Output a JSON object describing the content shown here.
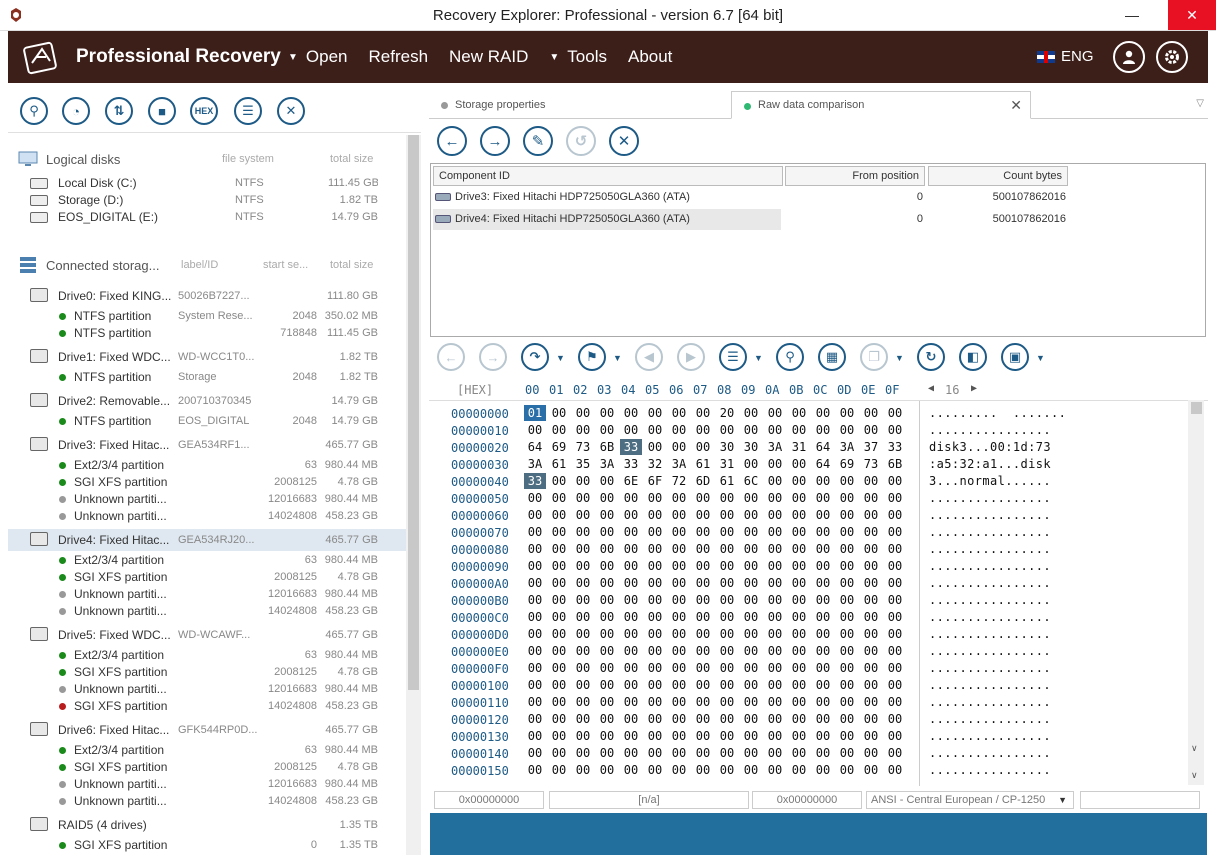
{
  "window": {
    "title": "Recovery Explorer: Professional - version 6.7 [64 bit]"
  },
  "header": {
    "brand": "Professional Recovery",
    "menu": [
      {
        "label": "Open",
        "dropdown": true
      },
      {
        "label": "Refresh",
        "dropdown": false
      },
      {
        "label": "New RAID",
        "dropdown": false
      },
      {
        "label": "Tools",
        "dropdown": true
      },
      {
        "label": "About",
        "dropdown": false
      }
    ],
    "language": "ENG"
  },
  "left_toolbar": {
    "hex_label": "HEX"
  },
  "logical_disks": {
    "title": "Logical disks",
    "col_fs": "file system",
    "col_size": "total size",
    "items": [
      {
        "name": "Local Disk (C:)",
        "fs": "NTFS",
        "size": "111.45 GB"
      },
      {
        "name": "Storage (D:)",
        "fs": "NTFS",
        "size": "1.82 TB"
      },
      {
        "name": "EOS_DIGITAL (E:)",
        "fs": "NTFS",
        "size": "14.79 GB"
      }
    ]
  },
  "connected_storage": {
    "title": "Connected storag...",
    "col_label": "label/ID",
    "col_start": "start se...",
    "col_size": "total size",
    "rows": [
      {
        "kind": "drive",
        "name": "Drive0: Fixed KING...",
        "label": "50026B7227...",
        "start": "",
        "size": "111.80 GB"
      },
      {
        "kind": "part",
        "status": "green",
        "name": "NTFS partition",
        "label": "System Rese...",
        "start": "2048",
        "size": "350.02 MB"
      },
      {
        "kind": "part",
        "status": "green",
        "name": "NTFS partition",
        "label": "",
        "start": "718848",
        "size": "111.45 GB"
      },
      {
        "kind": "drive",
        "name": "Drive1: Fixed WDC...",
        "label": "WD-WCC1T0...",
        "start": "",
        "size": "1.82 TB"
      },
      {
        "kind": "part",
        "status": "green",
        "name": "NTFS partition",
        "label": "Storage",
        "start": "2048",
        "size": "1.82 TB"
      },
      {
        "kind": "drive",
        "name": "Drive2: Removable...",
        "label": "200710370345",
        "start": "",
        "size": "14.79 GB"
      },
      {
        "kind": "part",
        "status": "green",
        "name": "NTFS partition",
        "label": "EOS_DIGITAL",
        "start": "2048",
        "size": "14.79 GB"
      },
      {
        "kind": "drive",
        "name": "Drive3: Fixed Hitac...",
        "label": "GEA534RF1...",
        "start": "",
        "size": "465.77 GB"
      },
      {
        "kind": "part",
        "status": "green",
        "name": "Ext2/3/4 partition",
        "label": "",
        "start": "63",
        "size": "980.44 MB"
      },
      {
        "kind": "part",
        "status": "green",
        "name": "SGI XFS partition",
        "label": "",
        "start": "2008125",
        "size": "4.78 GB"
      },
      {
        "kind": "part",
        "status": "gray",
        "name": "Unknown partiti...",
        "label": "",
        "start": "12016683",
        "size": "980.44 MB"
      },
      {
        "kind": "part",
        "status": "gray",
        "name": "Unknown partiti...",
        "label": "",
        "start": "14024808",
        "size": "458.23 GB"
      },
      {
        "kind": "drive",
        "selected": true,
        "name": "Drive4: Fixed Hitac...",
        "label": "GEA534RJ20...",
        "start": "",
        "size": "465.77 GB"
      },
      {
        "kind": "part",
        "status": "green",
        "name": "Ext2/3/4 partition",
        "label": "",
        "start": "63",
        "size": "980.44 MB"
      },
      {
        "kind": "part",
        "status": "green",
        "name": "SGI XFS partition",
        "label": "",
        "start": "2008125",
        "size": "4.78 GB"
      },
      {
        "kind": "part",
        "status": "gray",
        "name": "Unknown partiti...",
        "label": "",
        "start": "12016683",
        "size": "980.44 MB"
      },
      {
        "kind": "part",
        "status": "gray",
        "name": "Unknown partiti...",
        "label": "",
        "start": "14024808",
        "size": "458.23 GB"
      },
      {
        "kind": "drive",
        "name": "Drive5: Fixed WDC...",
        "label": "WD-WCAWF...",
        "start": "",
        "size": "465.77 GB"
      },
      {
        "kind": "part",
        "status": "green",
        "name": "Ext2/3/4 partition",
        "label": "",
        "start": "63",
        "size": "980.44 MB"
      },
      {
        "kind": "part",
        "status": "green",
        "name": "SGI XFS partition",
        "label": "",
        "start": "2008125",
        "size": "4.78 GB"
      },
      {
        "kind": "part",
        "status": "gray",
        "name": "Unknown partiti...",
        "label": "",
        "start": "12016683",
        "size": "980.44 MB"
      },
      {
        "kind": "part",
        "status": "red",
        "name": "SGI XFS partition",
        "label": "",
        "start": "14024808",
        "size": "458.23 GB"
      },
      {
        "kind": "drive",
        "name": "Drive6: Fixed Hitac...",
        "label": "GFK544RP0D...",
        "start": "",
        "size": "465.77 GB"
      },
      {
        "kind": "part",
        "status": "green",
        "name": "Ext2/3/4 partition",
        "label": "",
        "start": "63",
        "size": "980.44 MB"
      },
      {
        "kind": "part",
        "status": "green",
        "name": "SGI XFS partition",
        "label": "",
        "start": "2008125",
        "size": "4.78 GB"
      },
      {
        "kind": "part",
        "status": "gray",
        "name": "Unknown partiti...",
        "label": "",
        "start": "12016683",
        "size": "980.44 MB"
      },
      {
        "kind": "part",
        "status": "gray",
        "name": "Unknown partiti...",
        "label": "",
        "start": "14024808",
        "size": "458.23 GB"
      },
      {
        "kind": "raid",
        "name": "RAID5 (4 drives)",
        "label": "",
        "start": "",
        "size": "1.35 TB"
      },
      {
        "kind": "part",
        "status": "green",
        "name": "SGI XFS partition",
        "label": "",
        "start": "0",
        "size": "1.35 TB"
      }
    ]
  },
  "tabs": [
    {
      "label": "Storage properties",
      "active": false
    },
    {
      "label": "Raw data comparison",
      "active": true
    }
  ],
  "compare_table": {
    "headers": [
      "Component ID",
      "From position",
      "Count bytes"
    ],
    "rows": [
      {
        "id": "Drive3: Fixed Hitachi HDP725050GLA360 (ATA)",
        "from": "0",
        "count": "500107862016"
      },
      {
        "id": "Drive4: Fixed Hitachi HDP725050GLA360 (ATA)",
        "from": "0",
        "count": "500107862016"
      }
    ]
  },
  "hex": {
    "corner": "[HEX]",
    "columns": [
      "00",
      "01",
      "02",
      "03",
      "04",
      "05",
      "06",
      "07",
      "08",
      "09",
      "0A",
      "0B",
      "0C",
      "0D",
      "0E",
      "0F"
    ],
    "page_label": "16",
    "rows": [
      {
        "addr": "00000000",
        "bytes": [
          "01",
          "00",
          "00",
          "00",
          "00",
          "00",
          "00",
          "00",
          "20",
          "00",
          "00",
          "00",
          "00",
          "00",
          "00",
          "00"
        ],
        "ascii": ".........  ......."
      },
      {
        "addr": "00000010",
        "bytes": [
          "00",
          "00",
          "00",
          "00",
          "00",
          "00",
          "00",
          "00",
          "00",
          "00",
          "00",
          "00",
          "00",
          "00",
          "00",
          "00"
        ],
        "ascii": "................"
      },
      {
        "addr": "00000020",
        "bytes": [
          "64",
          "69",
          "73",
          "6B",
          "33",
          "00",
          "00",
          "00",
          "30",
          "30",
          "3A",
          "31",
          "64",
          "3A",
          "37",
          "33"
        ],
        "ascii": "disk3...00:1d:73"
      },
      {
        "addr": "00000030",
        "bytes": [
          "3A",
          "61",
          "35",
          "3A",
          "33",
          "32",
          "3A",
          "61",
          "31",
          "00",
          "00",
          "00",
          "64",
          "69",
          "73",
          "6B"
        ],
        "ascii": ":a5:32:a1...disk"
      },
      {
        "addr": "00000040",
        "bytes": [
          "33",
          "00",
          "00",
          "00",
          "6E",
          "6F",
          "72",
          "6D",
          "61",
          "6C",
          "00",
          "00",
          "00",
          "00",
          "00",
          "00"
        ],
        "ascii": "3...normal......"
      },
      {
        "addr": "00000050",
        "bytes": [
          "00",
          "00",
          "00",
          "00",
          "00",
          "00",
          "00",
          "00",
          "00",
          "00",
          "00",
          "00",
          "00",
          "00",
          "00",
          "00"
        ],
        "ascii": "................"
      },
      {
        "addr": "00000060",
        "bytes": [
          "00",
          "00",
          "00",
          "00",
          "00",
          "00",
          "00",
          "00",
          "00",
          "00",
          "00",
          "00",
          "00",
          "00",
          "00",
          "00"
        ],
        "ascii": "................"
      },
      {
        "addr": "00000070",
        "bytes": [
          "00",
          "00",
          "00",
          "00",
          "00",
          "00",
          "00",
          "00",
          "00",
          "00",
          "00",
          "00",
          "00",
          "00",
          "00",
          "00"
        ],
        "ascii": "................"
      },
      {
        "addr": "00000080",
        "bytes": [
          "00",
          "00",
          "00",
          "00",
          "00",
          "00",
          "00",
          "00",
          "00",
          "00",
          "00",
          "00",
          "00",
          "00",
          "00",
          "00"
        ],
        "ascii": "................"
      },
      {
        "addr": "00000090",
        "bytes": [
          "00",
          "00",
          "00",
          "00",
          "00",
          "00",
          "00",
          "00",
          "00",
          "00",
          "00",
          "00",
          "00",
          "00",
          "00",
          "00"
        ],
        "ascii": "................"
      },
      {
        "addr": "000000A0",
        "bytes": [
          "00",
          "00",
          "00",
          "00",
          "00",
          "00",
          "00",
          "00",
          "00",
          "00",
          "00",
          "00",
          "00",
          "00",
          "00",
          "00"
        ],
        "ascii": "................"
      },
      {
        "addr": "000000B0",
        "bytes": [
          "00",
          "00",
          "00",
          "00",
          "00",
          "00",
          "00",
          "00",
          "00",
          "00",
          "00",
          "00",
          "00",
          "00",
          "00",
          "00"
        ],
        "ascii": "................"
      },
      {
        "addr": "000000C0",
        "bytes": [
          "00",
          "00",
          "00",
          "00",
          "00",
          "00",
          "00",
          "00",
          "00",
          "00",
          "00",
          "00",
          "00",
          "00",
          "00",
          "00"
        ],
        "ascii": "................"
      },
      {
        "addr": "000000D0",
        "bytes": [
          "00",
          "00",
          "00",
          "00",
          "00",
          "00",
          "00",
          "00",
          "00",
          "00",
          "00",
          "00",
          "00",
          "00",
          "00",
          "00"
        ],
        "ascii": "................"
      },
      {
        "addr": "000000E0",
        "bytes": [
          "00",
          "00",
          "00",
          "00",
          "00",
          "00",
          "00",
          "00",
          "00",
          "00",
          "00",
          "00",
          "00",
          "00",
          "00",
          "00"
        ],
        "ascii": "................"
      },
      {
        "addr": "000000F0",
        "bytes": [
          "00",
          "00",
          "00",
          "00",
          "00",
          "00",
          "00",
          "00",
          "00",
          "00",
          "00",
          "00",
          "00",
          "00",
          "00",
          "00"
        ],
        "ascii": "................"
      },
      {
        "addr": "00000100",
        "bytes": [
          "00",
          "00",
          "00",
          "00",
          "00",
          "00",
          "00",
          "00",
          "00",
          "00",
          "00",
          "00",
          "00",
          "00",
          "00",
          "00"
        ],
        "ascii": "................"
      },
      {
        "addr": "00000110",
        "bytes": [
          "00",
          "00",
          "00",
          "00",
          "00",
          "00",
          "00",
          "00",
          "00",
          "00",
          "00",
          "00",
          "00",
          "00",
          "00",
          "00"
        ],
        "ascii": "................"
      },
      {
        "addr": "00000120",
        "bytes": [
          "00",
          "00",
          "00",
          "00",
          "00",
          "00",
          "00",
          "00",
          "00",
          "00",
          "00",
          "00",
          "00",
          "00",
          "00",
          "00"
        ],
        "ascii": "................"
      },
      {
        "addr": "00000130",
        "bytes": [
          "00",
          "00",
          "00",
          "00",
          "00",
          "00",
          "00",
          "00",
          "00",
          "00",
          "00",
          "00",
          "00",
          "00",
          "00",
          "00"
        ],
        "ascii": "................"
      },
      {
        "addr": "00000140",
        "bytes": [
          "00",
          "00",
          "00",
          "00",
          "00",
          "00",
          "00",
          "00",
          "00",
          "00",
          "00",
          "00",
          "00",
          "00",
          "00",
          "00"
        ],
        "ascii": "................"
      },
      {
        "addr": "00000150",
        "bytes": [
          "00",
          "00",
          "00",
          "00",
          "00",
          "00",
          "00",
          "00",
          "00",
          "00",
          "00",
          "00",
          "00",
          "00",
          "00",
          "00"
        ],
        "ascii": "................"
      }
    ],
    "highlighted": [
      [
        2,
        4
      ],
      [
        4,
        0
      ]
    ],
    "cursor": [
      0,
      0
    ]
  },
  "status_bar": {
    "offset": "0x00000000",
    "value": "[n/a]",
    "selection": "0x00000000",
    "encoding": "ANSI - Central European / CP-1250"
  },
  "colors": {
    "header_bg": "#3d1f1a",
    "accent": "#1d5a86",
    "bottom_bar": "#226f9d",
    "green": "#1a8a1a",
    "red": "#b81c1c",
    "gray": "#999999"
  }
}
